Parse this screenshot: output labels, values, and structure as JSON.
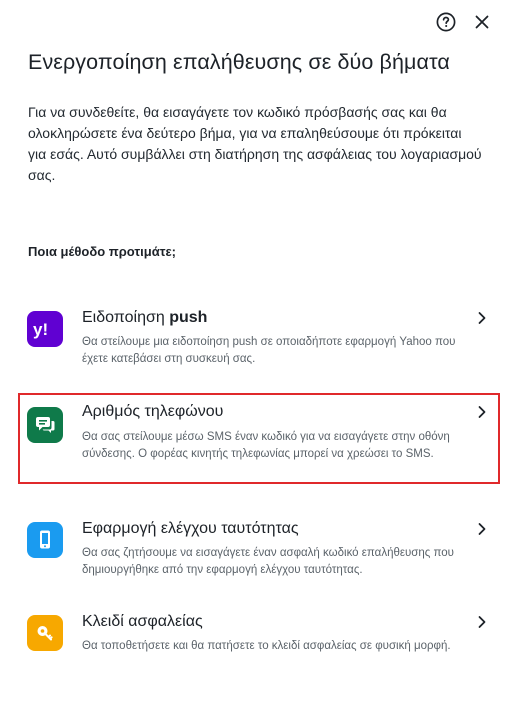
{
  "header": {
    "help_icon": "help-circle-icon",
    "close_icon": "close-icon"
  },
  "title": "Ενεργοποίηση επαλήθευσης σε δύο βήματα",
  "description": "Για να συνδεθείτε, θα εισαγάγετε τον κωδικό πρόσβασής σας και θα ολοκληρώσετε ένα δεύτερο βήμα, για να επαληθεύσουμε ότι πρόκειται για εσάς. Αυτό συμβάλλει στη διατήρηση της ασφάλειας του λογαριασμού σας.",
  "question": "Ποια μέθοδο προτιμάτε;",
  "options": [
    {
      "title_prefix": "Ειδοποίηση ",
      "title_bold": "push",
      "description": "Θα στείλουμε μια ειδοποίηση push σε οποιαδήποτε εφαρμογή Yahoo που έχετε κατεβάσει στη συσκευή σας.",
      "icon": "yahoo-logo-icon",
      "icon_color": "#6001d2"
    },
    {
      "title": "Αριθμός τηλεφώνου",
      "description": "Θα σας στείλουμε μέσω SMS έναν κωδικό για να εισαγάγετε στην οθόνη σύνδεσης. Ο φορέας κινητής τηλεφωνίας μπορεί να χρεώσει το SMS.",
      "icon": "chat-bubbles-icon",
      "icon_color": "#0f7a4a",
      "highlighted": true
    },
    {
      "title": "Εφαρμογή ελέγχου ταυτότητας",
      "description": "Θα σας ζητήσουμε να εισαγάγετε έναν ασφαλή κωδικό επαλήθευσης που δημιουργήθηκε από την εφαρμογή ελέγχου ταυτότητας.",
      "icon": "smartphone-icon",
      "icon_color": "#1a9bf0"
    },
    {
      "title": "Κλειδί ασφαλείας",
      "description": "Θα τοποθετήσετε και θα πατήσετε το κλειδί ασφαλείας σε φυσική μορφή.",
      "icon": "key-icon",
      "icon_color": "#f7a800"
    }
  ],
  "colors": {
    "highlight_border": "#e0292b"
  }
}
